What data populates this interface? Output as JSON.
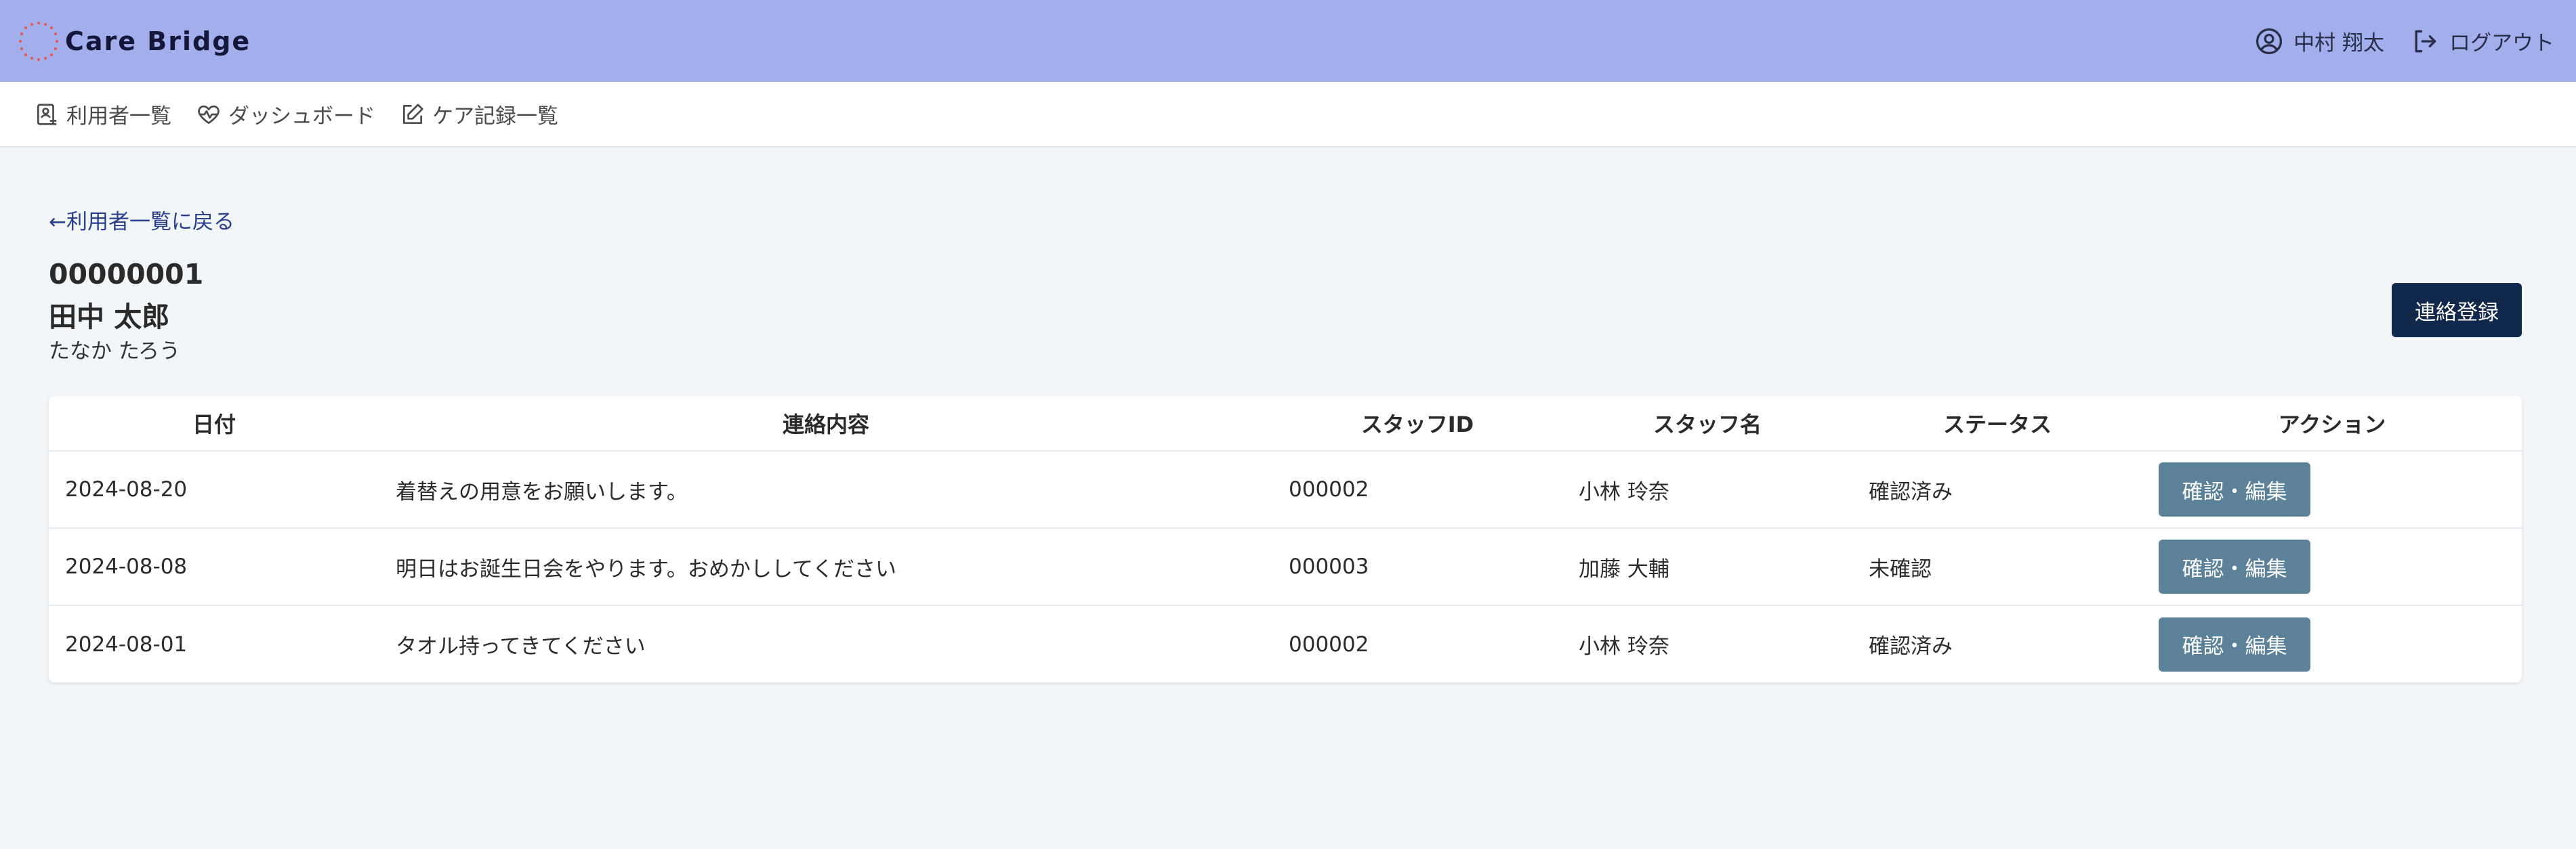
{
  "header": {
    "app_name": "Care Bridge",
    "user_name": "中村 翔太",
    "logout_label": "ログアウト",
    "background_color": "#a3afed"
  },
  "nav": {
    "items": [
      {
        "label": "利用者一覧",
        "icon": "user-list-icon"
      },
      {
        "label": "ダッシュボード",
        "icon": "heart-pulse-icon"
      },
      {
        "label": "ケア記録一覧",
        "icon": "edit-icon"
      }
    ]
  },
  "main": {
    "back_link": "←利用者一覧に戻る",
    "user_id": "00000001",
    "user_name": "田中 太郎",
    "user_kana": "たなか たろう",
    "register_button": "連絡登録"
  },
  "table": {
    "headers": [
      "日付",
      "連絡内容",
      "スタッフID",
      "スタッフ名",
      "ステータス",
      "アクション"
    ],
    "rows": [
      {
        "date": "2024-08-20",
        "content": "着替えの用意をお願いします。",
        "staff_id": "000002",
        "staff_name": "小林 玲奈",
        "status": "確認済み",
        "action": "確認・編集"
      },
      {
        "date": "2024-08-08",
        "content": "明日はお誕生日会をやります。おめかししてください",
        "staff_id": "000003",
        "staff_name": "加藤 大輔",
        "status": "未確認",
        "action": "確認・編集"
      },
      {
        "date": "2024-08-01",
        "content": "タオル持ってきてください",
        "staff_id": "000002",
        "staff_name": "小林 玲奈",
        "status": "確認済み",
        "action": "確認・編集"
      }
    ]
  },
  "colors": {
    "primary_button": "#10284b",
    "action_button": "#5b8299",
    "link": "#2a3f8f"
  }
}
